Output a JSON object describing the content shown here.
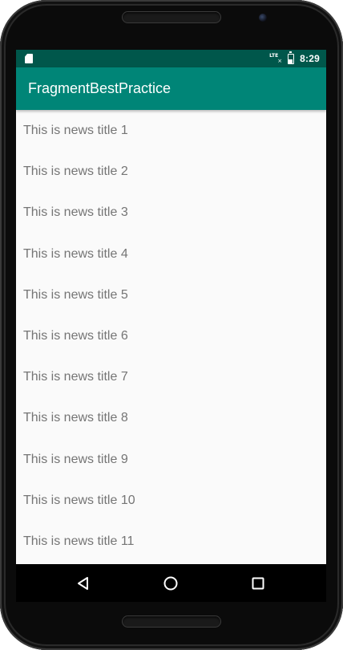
{
  "status_bar": {
    "time": "8:29",
    "network": "LTE",
    "icons": [
      "sim-card-icon",
      "lte-signal-icon",
      "battery-icon"
    ]
  },
  "app_bar": {
    "title": "FragmentBestPractice",
    "color": "#008577"
  },
  "colors": {
    "status_bar": "#00574B",
    "app_bar": "#008577",
    "list_background": "#FAFAFA",
    "list_text": "#757575"
  },
  "news": [
    {
      "title": "This is news title 1"
    },
    {
      "title": "This is news title 2"
    },
    {
      "title": "This is news title 3"
    },
    {
      "title": "This is news title 4"
    },
    {
      "title": "This is news title 5"
    },
    {
      "title": "This is news title 6"
    },
    {
      "title": "This is news title 7"
    },
    {
      "title": "This is news title 8"
    },
    {
      "title": "This is news title 9"
    },
    {
      "title": "This is news title 10"
    },
    {
      "title": "This is news title 11"
    }
  ],
  "nav_bar": {
    "buttons": [
      "back-icon",
      "home-icon",
      "recents-icon"
    ]
  }
}
